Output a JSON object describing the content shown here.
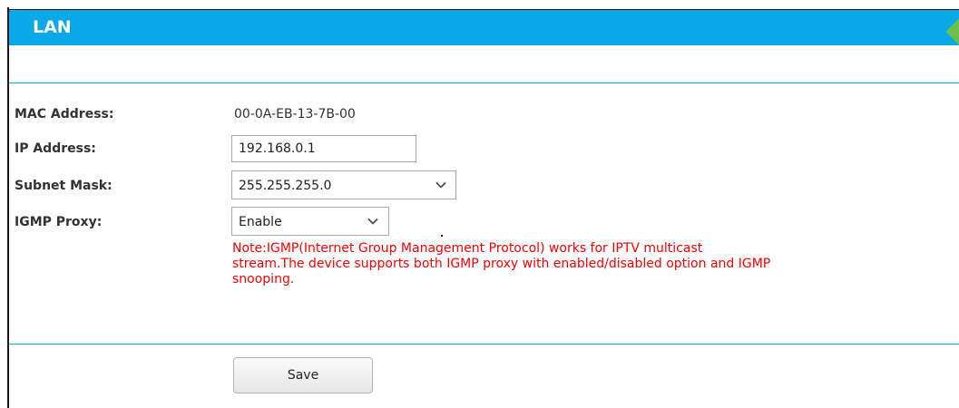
{
  "header": {
    "title": "LAN"
  },
  "form": {
    "mac_address": {
      "label": "MAC Address:",
      "value": "00-0A-EB-13-7B-00"
    },
    "ip_address": {
      "label": "IP Address:",
      "value": "192.168.0.1"
    },
    "subnet_mask": {
      "label": "Subnet Mask:",
      "selected": "255.255.255.0"
    },
    "igmp_proxy": {
      "label": "IGMP Proxy:",
      "selected": "Enable"
    },
    "note_lines": [
      "Note:IGMP(Internet Group Management Protocol) works for IPTV multicast",
      "stream.The device supports both IGMP proxy with enabled/disabled option and IGMP",
      "snooping."
    ]
  },
  "actions": {
    "save_label": "Save"
  },
  "colors": {
    "header_bar": "#0aa8e7",
    "divider": "#0aa8e7",
    "note_text": "#ff0000",
    "corner_badge": "#6cc04a"
  },
  "icons": {
    "dropdown": "chevron-down-icon"
  }
}
